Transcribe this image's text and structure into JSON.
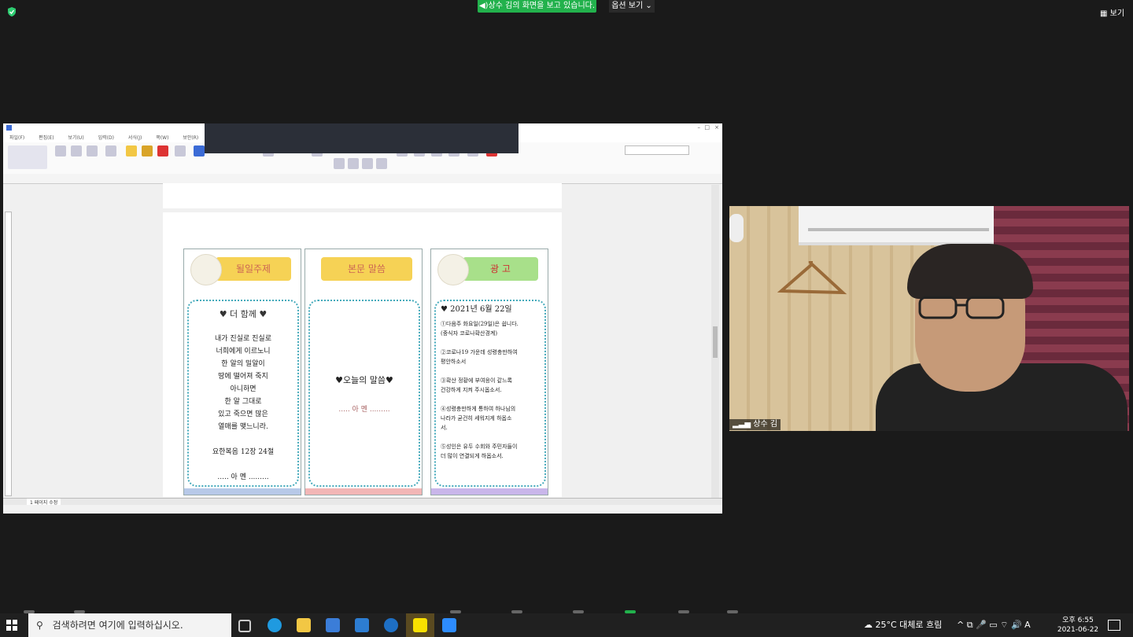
{
  "zoom": {
    "share_banner": "상수 김의 화면을 보고 있습니다.",
    "view_options": "옵션 보기 ⌄",
    "view_button": "▦ 보기"
  },
  "document": {
    "columns": [
      {
        "banner": "될일주제",
        "color": "#b7c9e8",
        "heading": "♥ 더 함께 ♥",
        "lines": [
          "내가 진실로 진실로",
          "너희에게 이르노니",
          "한 알의 밀알이",
          "땅에 떨어져 죽지",
          "아니하면",
          "한 알 그대로",
          "있고 죽으면 많은",
          "열매를 맺느니라.",
          "",
          "요한복음 12장 24절",
          "",
          "..... 아 멘 ........."
        ]
      },
      {
        "banner": "본문 말씀",
        "color": "#f2b6b6",
        "heading": "",
        "lines": [
          "♥오늘의 말씀♥",
          "",
          "..... 아 멘 ........."
        ]
      },
      {
        "banner": "광 고",
        "color": "#c9b6ea",
        "heading": "♥ 2021년 6월 22일",
        "lines": [
          "①다음주 화요일(29일)은 쉽니다.",
          "(중식자 코로나확산경계)",
          "",
          "②코로나19 가운데 성령충만하여",
          "평안하소서",
          "",
          "③확산 정황에 부여응이 같느록",
          "건강하게 지켜 주시옵소서.",
          "",
          "④성령충만하게 통하여 하나님의",
          "나라가 굳건히 세워지게 하옵소",
          "서.",
          "",
          "⑤성인은 유두 수회와 주민자들이",
          "더 많이 연결되게 하옵소서."
        ]
      }
    ],
    "tab_label": "1 페이지 수정"
  },
  "video": {
    "participant_name": "상수 김"
  },
  "taskbar": {
    "search_placeholder": "검색하려면 여기에 입력하십시오.",
    "weather": "25°C 대체로 흐림",
    "tray": "^ ⧉ 🎤 ▭ ⌔ 🔊 A",
    "time": "오후 6:55",
    "date": "2021-06-22"
  }
}
